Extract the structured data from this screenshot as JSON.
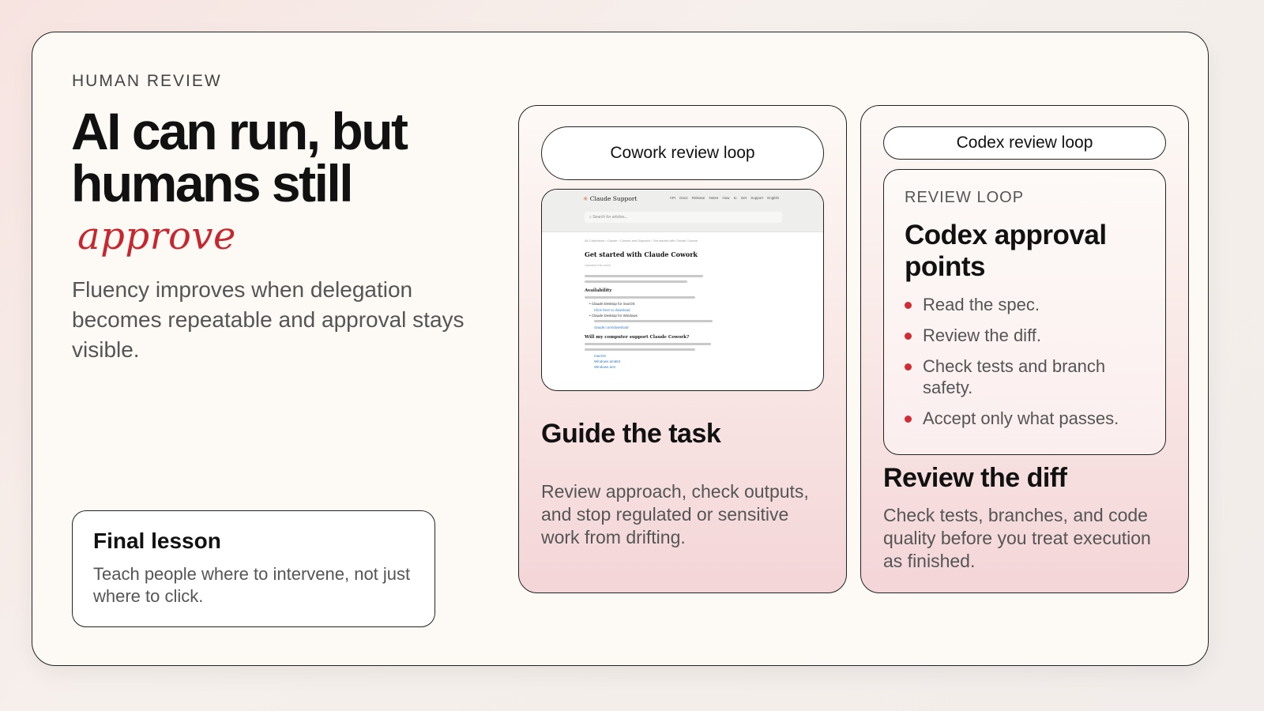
{
  "slide": {
    "eyebrow": "HUMAN REVIEW",
    "headline": "AI can run, but humans still",
    "accent_word": "approve",
    "lede": "Fluency improves when delegation becomes repeatable and approval stays visible.",
    "accent_color": "#c8262f"
  },
  "lesson": {
    "title": "Final lesson",
    "body": "Teach people where to intervene, not just where to click."
  },
  "cowork_card": {
    "pill": "Cowork review loop",
    "title": "Guide the task",
    "body": "Review approach, check outputs, and stop regulated or sensitive work from drifting.",
    "screenshot": {
      "logo": "Claude Support",
      "nav": "API Docs  Release Notes  How to Get Support  English",
      "search_placeholder": "Search for articles...",
      "breadcrumb": "All Collections › Claude › Cowork and Dispatch › Get started with Claude Cowork",
      "title": "Get started with Claude Cowork",
      "updated": "Updated this week",
      "section_1": "Availability",
      "item_mac": "Claude Desktop for macOS",
      "item_mac_link": "Click here to download",
      "item_win": "Claude Desktop for Windows",
      "item_win_link": "claude.com/download",
      "section_2": "Will my computer support Claude Cowork?",
      "link_1": "macOS",
      "link_2": "Windows amd64",
      "link_3": "Windows arm"
    }
  },
  "codex_card": {
    "pill": "Codex review loop",
    "inner_eyebrow": "REVIEW LOOP",
    "inner_title": "Codex approval points",
    "bullets": [
      "Read the spec.",
      "Review the diff.",
      "Check tests and branch safety.",
      "Accept only what passes."
    ],
    "title": "Review the diff",
    "body": "Check tests, branches, and code quality before you treat execution as finished.",
    "bullet_color": "#d22b33"
  }
}
